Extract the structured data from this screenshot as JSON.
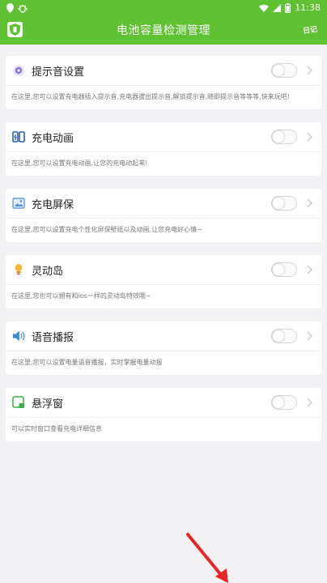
{
  "status_bar": {
    "left_icons": [
      "location-icon",
      "bug-icon"
    ],
    "time": "11:38",
    "right_icons": [
      "wifi-icon",
      "signal-icon",
      "battery-icon"
    ]
  },
  "app_bar": {
    "title": "电池容量检测管理",
    "action_label": "日记"
  },
  "items": [
    {
      "key": "sound",
      "icon": "sound-setting-icon",
      "title": "提示音设置",
      "desc": "在这里,您可以设置充电器插入提示音,充电器拔出提示音,解锁提示音,随即提示音等等等,快来玩吧!",
      "enabled": false
    },
    {
      "key": "anim",
      "icon": "charging-animation-icon",
      "title": "充电动画",
      "desc": "在这里,您可以设置充电动画,让您的充电动起来!",
      "enabled": false
    },
    {
      "key": "screensaver",
      "icon": "charging-screensaver-icon",
      "title": "充电屏保",
      "desc": "在这里,您可以设置充电个性化屏保壁纸以及动画,让您充电好心情~",
      "enabled": false
    },
    {
      "key": "island",
      "icon": "dynamic-island-icon",
      "title": "灵动岛",
      "desc": "在这里,您也可以拥有和ios一样的灵动岛特效哦~",
      "enabled": false
    },
    {
      "key": "voice",
      "icon": "voice-broadcast-icon",
      "title": "语音播报",
      "desc": "在这里,您可以设置电量语音播报，实时掌握电量动报",
      "enabled": false
    },
    {
      "key": "floating",
      "icon": "floating-window-icon",
      "title": "悬浮窗",
      "desc": "可以实时窗口查看充电详细信息",
      "enabled": false
    }
  ],
  "colors": {
    "accent": "#5fc232",
    "arrow": "#e8262a"
  }
}
